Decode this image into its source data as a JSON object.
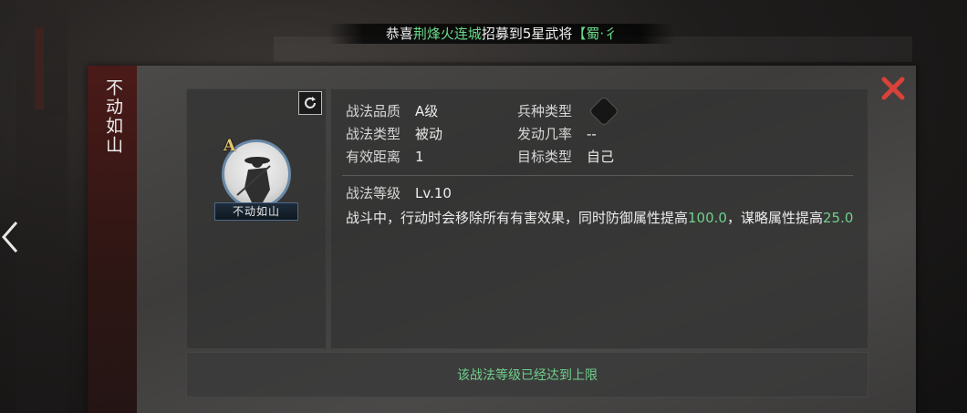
{
  "ticker": {
    "prefix": "恭喜",
    "player": "荆烽火连城",
    "middle": "招募到5星武将",
    "hero_fragment": "【蜀·彳"
  },
  "skill": {
    "title_vertical": "不动如山",
    "grade_badge": "A",
    "avatar_label": "不动如山"
  },
  "info": {
    "quality_label": "战法品质",
    "quality_value": "A级",
    "troop_label": "兵种类型",
    "type_label": "战法类型",
    "type_value": "被动",
    "trigger_label": "发动几率",
    "trigger_value": "--",
    "range_label": "有效距离",
    "range_value": "1",
    "target_label": "目标类型",
    "target_value": "自己",
    "level_label": "战法等级",
    "level_value": "Lv.10"
  },
  "description": {
    "part1": "战斗中，行动时会移除所有有害效果，同时防御属性提高",
    "num1": "100.0",
    "part2": "，谋略属性提高",
    "num2": "25.0"
  },
  "footer": {
    "max_level_text": "该战法等级已经达到上限"
  },
  "icons": {
    "close": "close-x-icon",
    "refresh": "refresh-icon",
    "troop": "troop-type-icon",
    "back": "chevron-left-icon"
  },
  "colors": {
    "accent_green": "#6fd08c",
    "close_red": "#d9423a",
    "grade_gold": "#e4c56a"
  }
}
